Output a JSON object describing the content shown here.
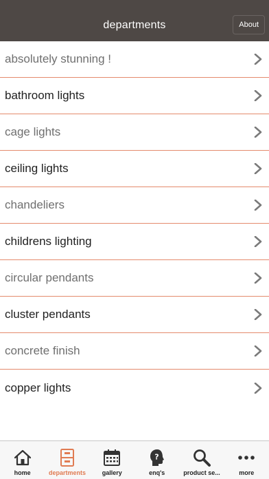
{
  "header": {
    "title": "departments",
    "about_label": "About"
  },
  "departments": [
    {
      "label": "absolutely stunning !"
    },
    {
      "label": "bathroom lights"
    },
    {
      "label": "cage lights"
    },
    {
      "label": "ceiling lights"
    },
    {
      "label": "chandeliers"
    },
    {
      "label": "childrens lighting"
    },
    {
      "label": "circular pendants"
    },
    {
      "label": "cluster pendants"
    },
    {
      "label": "concrete finish"
    },
    {
      "label": "copper lights"
    }
  ],
  "tabbar": {
    "items": [
      {
        "label": "home",
        "icon": "home-icon"
      },
      {
        "label": "departments",
        "icon": "cabinet-icon",
        "active": true
      },
      {
        "label": "gallery",
        "icon": "calendar-icon"
      },
      {
        "label": "enq's",
        "icon": "question-head-icon"
      },
      {
        "label": "product se...",
        "icon": "magnifier-icon"
      },
      {
        "label": "more",
        "icon": "more-dots-icon"
      }
    ]
  },
  "colors": {
    "navbar": "#4e4845",
    "accent": "#e07b52",
    "divider": "#e48a6c"
  }
}
